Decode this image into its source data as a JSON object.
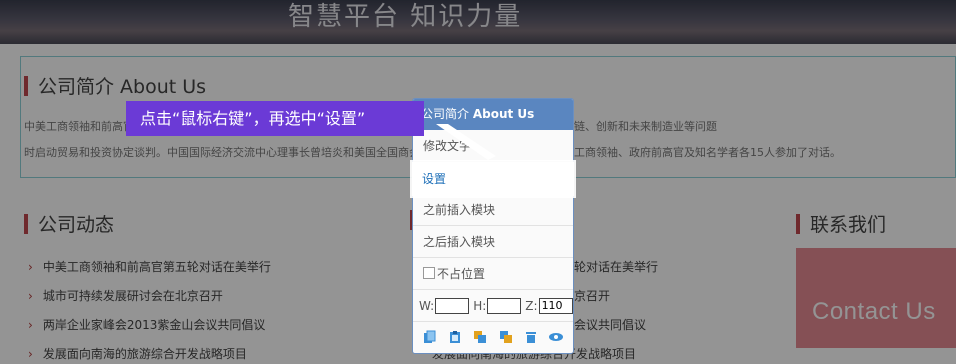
{
  "banner": {
    "title": "智慧平台 知识力量"
  },
  "about": {
    "heading": "公司简介 About Us",
    "line1": "中美工商领袖和前高官第五轮对话在美举行，双方就贸易投资、基础设施投资、中美更全面经济伙伴关系中的供应链、创新和未来制造业等问题",
    "line2": "时启动贸易和投资协定谈判。中国国际经济交流中心理事长曾培炎和美国全国商会、中国国际经济交流中心、美国工商领袖、政府前高官及知名学者各15人参加了对话。"
  },
  "news_left": {
    "heading": "公司动态",
    "items": [
      "中美工商领袖和前高官第五轮对话在美举行",
      "城市可持续发展研讨会在北京召开",
      "两岸企业家峰会2013紫金山会议共同倡议",
      "发展面向南海的旅游综合开发战略项目"
    ]
  },
  "news_right": {
    "items": [
      "轮对话在美举行",
      "京召开",
      "会议共同倡议",
      "发展面向南海的旅游综合开发战略项目"
    ]
  },
  "contact": {
    "heading": "联系我们",
    "banner_text": "Contact Us"
  },
  "menu": {
    "header_prefix": "公司简介",
    "header_suffix": "About Us",
    "edit_text": "修改文字",
    "settings": "设置",
    "insert_before": "之前插入模块",
    "insert_after": "之后插入模块",
    "no_position": "不占位置",
    "w_label": "W:",
    "h_label": "H:",
    "z_label": "Z:",
    "w_value": "",
    "h_value": "",
    "z_value": "110",
    "icons": [
      "copy-icon",
      "paste-icon",
      "duplicate-icon",
      "layer-icon",
      "delete-icon",
      "eye-icon"
    ]
  },
  "tooltip": {
    "text": "点击“鼠标右键”，再选中“设置”"
  }
}
